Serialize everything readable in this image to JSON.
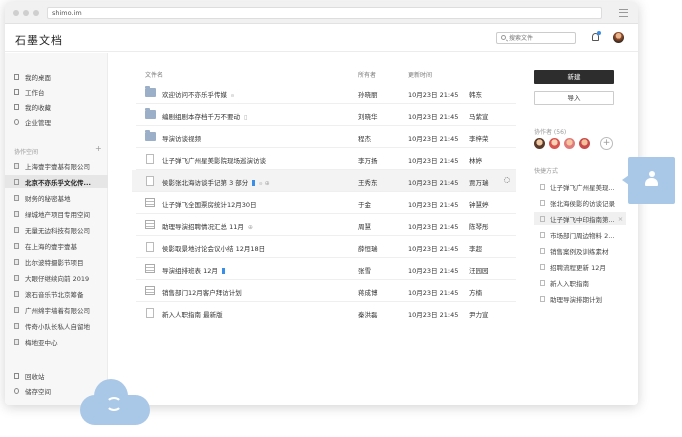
{
  "browser": {
    "url": "shimo.im"
  },
  "header": {
    "logo": "石墨文档",
    "search_placeholder": "搜索文件"
  },
  "sidebar": {
    "nav": [
      {
        "label": "我的桌面",
        "icon": "desktop-icon"
      },
      {
        "label": "工作台",
        "icon": "workbench-icon"
      },
      {
        "label": "我的收藏",
        "icon": "star-icon"
      },
      {
        "label": "企业管理",
        "icon": "gear-icon"
      }
    ],
    "section_label": "协作空间",
    "section_add": "+",
    "spaces": [
      "上海壹宇壹基有限公司",
      "北京不亦乐乎文化传...",
      "财务的秘密基地",
      "绿城地产项目专用空间",
      "无量无边科技有限公司",
      "在上海的壹宇壹基",
      "比尔波特摄影节项目",
      "大眼仔继续向前 2019",
      "滚石音乐节北京筹备",
      "广州绵宇墙着有限公司",
      "传奇小队长私人自留地",
      "梅地亚中心"
    ],
    "bottom": [
      "回收站",
      "储存空间"
    ]
  },
  "table": {
    "headers": {
      "name": "文件名",
      "owner": "所有者",
      "updated": "更新时间"
    },
    "rows": [
      {
        "type": "folder",
        "name": "欢迎访问不亦乐乎传媒",
        "tag": "ဓ",
        "owner": "孙晓丽",
        "time": "10月23日 21:45",
        "editor": "韩东"
      },
      {
        "type": "folder",
        "name": "编剧组剧本存档千万不要动",
        "tag": "▯",
        "owner": "刘晓华",
        "time": "10月23日 21:45",
        "editor": "马紫宣"
      },
      {
        "type": "folder",
        "name": "导演访谈视频",
        "tag": "",
        "owner": "程杰",
        "time": "10月23日 21:45",
        "editor": "李梓荣"
      },
      {
        "type": "doc",
        "name": "让子弹飞广州星美影院现场巡演访谈",
        "tag": "",
        "owner": "李万扬",
        "time": "10月23日 21:45",
        "editor": "林婷"
      },
      {
        "type": "doc",
        "name": "侯影张北海访谈手记第 3 部分",
        "tag": "bookmark",
        "owner": "王秀东",
        "time": "10月23日 21:45",
        "editor": "贾万瑞"
      },
      {
        "type": "sheet",
        "name": "让子弹飞全国票房统计12月30日",
        "tag": "",
        "owner": "于金",
        "time": "10月23日 21:45",
        "editor": "钟慧婷"
      },
      {
        "type": "sheet",
        "name": "助理导演招聘情况汇总 11月",
        "tag": "⊕",
        "owner": "周慧",
        "time": "10月23日 21:45",
        "editor": "陈琴彤"
      },
      {
        "type": "doc",
        "name": "侯影取景地讨论会议小结 12月18日",
        "tag": "",
        "owner": "薛恒瑞",
        "time": "10月23日 21:45",
        "editor": "李超"
      },
      {
        "type": "sheet",
        "name": "导演组排班表 12月",
        "tag": "bookmark",
        "owner": "张雪",
        "time": "10月23日 21:45",
        "editor": "汪园园"
      },
      {
        "type": "sheet",
        "name": "销售部门12月客户拜访计划",
        "tag": "",
        "owner": "蒋成博",
        "time": "10月23日 21:45",
        "editor": "方楠"
      },
      {
        "type": "doc",
        "name": "新入人职指南 最新版",
        "tag": "",
        "owner": "秦洪磊",
        "time": "10月23日 21:45",
        "editor": "尹力宣"
      }
    ]
  },
  "right": {
    "new_label": "新建",
    "import_label": "导入",
    "collab_label": "协作者 (56)",
    "collab_add": "+",
    "quick_label": "快捷方式",
    "quick": [
      "让子弹飞广州星美现...",
      "张北海侯影的访谈记录",
      "让子弹飞中印指南第...",
      "市场部门周边物料 2...",
      "销售案例及训练素材",
      "招聘流程更新 12月",
      "新人入职指南",
      "助理导演排期计划"
    ],
    "quick_close": "×"
  },
  "colors": {
    "accent": "#3a8ee6",
    "card": "#a9c8e8",
    "dark_button": "#2d2d2d"
  }
}
